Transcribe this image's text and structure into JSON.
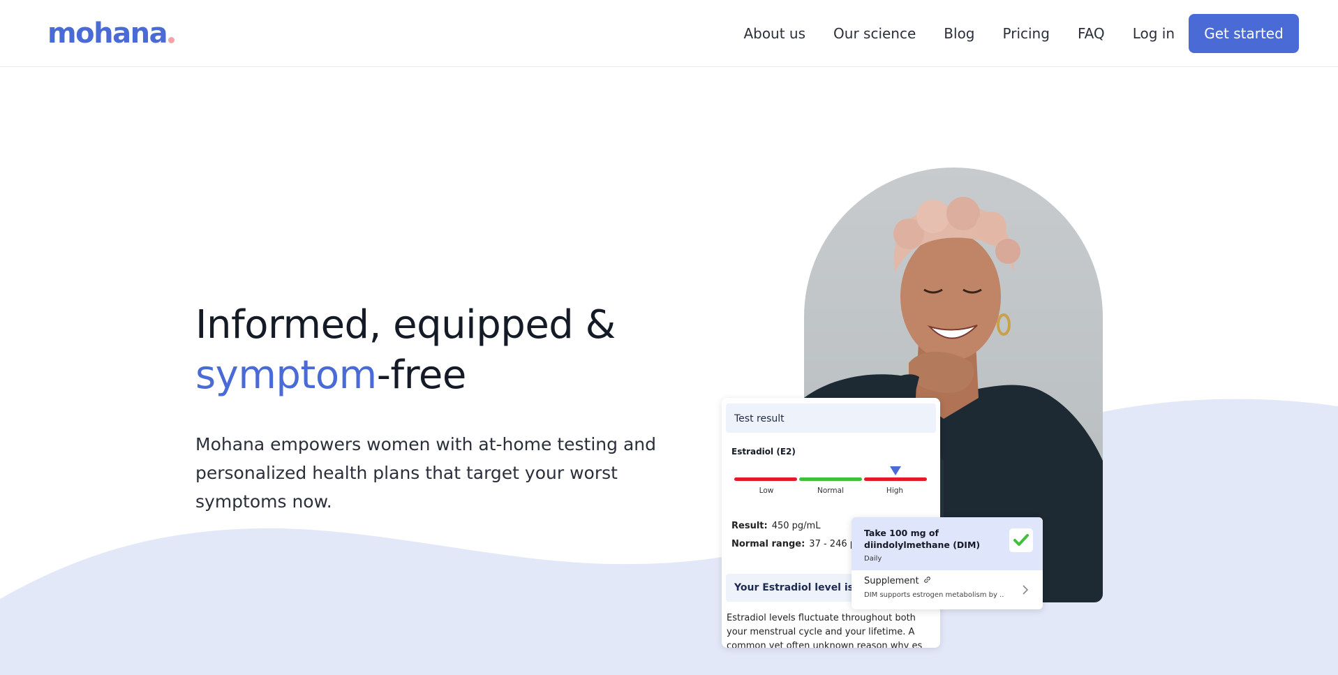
{
  "brand": {
    "name": "mohana",
    "accent": "#4a6bd6",
    "dot_color": "#f5a3a6"
  },
  "nav": {
    "links": [
      "About us",
      "Our science",
      "Blog",
      "Pricing",
      "FAQ"
    ],
    "login": "Log in",
    "cta": "Get started"
  },
  "hero": {
    "headline_line1": "Informed, equipped &",
    "headline_accent": "symptom",
    "headline_rest": "-free",
    "subtext": "Mohana empowers women with at-home testing and personalized health plans that target your worst symptoms now."
  },
  "test_card": {
    "header": "Test result",
    "hormone": "Estradiol (E2)",
    "range_labels": [
      "Low",
      "Normal",
      "High"
    ],
    "range_colors": [
      "#e6192b",
      "#40c03a",
      "#e6192b"
    ],
    "result_label": "Result:",
    "result_value": "450 pg/mL",
    "normal_label": "Normal range:",
    "normal_value": "37 - 246 pg",
    "notice": "Your Estradiol level is hig",
    "body": "Estradiol levels fluctuate throughout both your menstrual cycle and your lifetime. A common yet often unknown reason why es"
  },
  "plan_card": {
    "title": "Take 100 mg of diindolylmethane (DIM)",
    "frequency": "Daily",
    "category": "Supplement",
    "description": "DIM supports estrogen metabolism by ..."
  },
  "icons": {
    "check": "check-icon",
    "link": "link-icon",
    "chevron": "chevron-right-icon"
  }
}
